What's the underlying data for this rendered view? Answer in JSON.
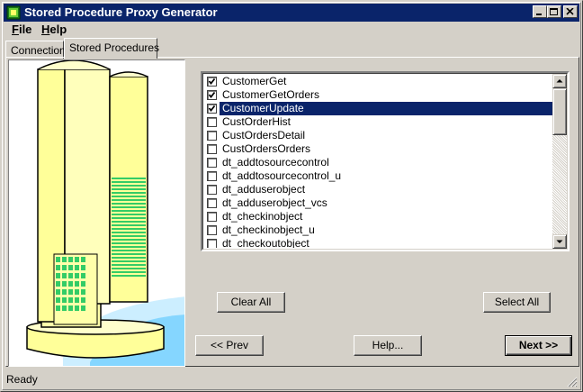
{
  "window": {
    "title": "Stored Procedure Proxy Generator"
  },
  "menu": [
    {
      "label": "File",
      "accel": "F",
      "rest": "ile"
    },
    {
      "label": "Help",
      "accel": "H",
      "rest": "elp"
    }
  ],
  "tabs": [
    {
      "label": "Connection",
      "active": false
    },
    {
      "label": "Stored Procedures",
      "active": true
    }
  ],
  "procedures": [
    {
      "name": "CustomerGet",
      "checked": true,
      "selected": false
    },
    {
      "name": "CustomerGetOrders",
      "checked": true,
      "selected": false
    },
    {
      "name": "CustomerUpdate",
      "checked": true,
      "selected": true
    },
    {
      "name": "CustOrderHist",
      "checked": false,
      "selected": false
    },
    {
      "name": "CustOrdersDetail",
      "checked": false,
      "selected": false
    },
    {
      "name": "CustOrdersOrders",
      "checked": false,
      "selected": false
    },
    {
      "name": "dt_addtosourcecontrol",
      "checked": false,
      "selected": false
    },
    {
      "name": "dt_addtosourcecontrol_u",
      "checked": false,
      "selected": false
    },
    {
      "name": "dt_adduserobject",
      "checked": false,
      "selected": false
    },
    {
      "name": "dt_adduserobject_vcs",
      "checked": false,
      "selected": false
    },
    {
      "name": "dt_checkinobject",
      "checked": false,
      "selected": false
    },
    {
      "name": "dt_checkinobject_u",
      "checked": false,
      "selected": false
    },
    {
      "name": "dt_checkoutobject",
      "checked": false,
      "selected": false
    }
  ],
  "buttons": {
    "clear_all": "Clear All",
    "select_all": "Select All",
    "prev": "<< Prev",
    "help": "Help...",
    "next": "Next >>"
  },
  "status": {
    "text": "Ready"
  },
  "colors": {
    "titlebar": "#0a246a",
    "selection": "#0a246a",
    "face": "#d4d0c8",
    "illustration_yellow": "#ffff99",
    "illustration_green": "#33cc66"
  }
}
